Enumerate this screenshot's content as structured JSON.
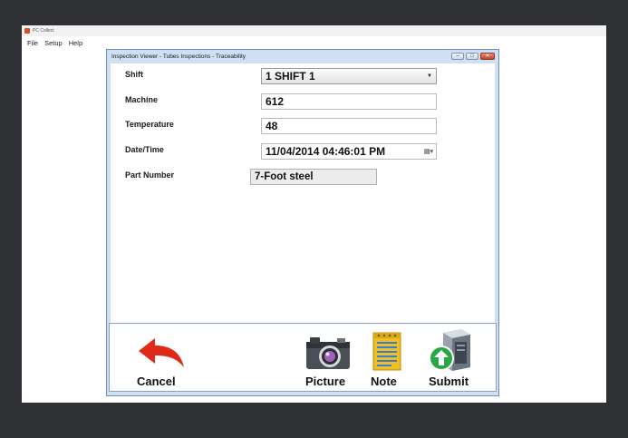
{
  "app": {
    "title": "PC Collect",
    "menu": [
      "File",
      "Setup",
      "Help"
    ]
  },
  "dialog": {
    "title": "Inspection Viewer - Tubes Inspections - Traceability"
  },
  "form": {
    "shift": {
      "label": "Shift",
      "value": "1 SHIFT 1"
    },
    "machine": {
      "label": "Machine",
      "value": "612"
    },
    "temperature": {
      "label": "Temperature",
      "value": "48"
    },
    "datetime": {
      "label": "Date/Time",
      "value": "11/04/2014 04:46:01 PM"
    },
    "part_number": {
      "label": "Part Number",
      "value": "7-Foot steel"
    }
  },
  "toolbar": {
    "cancel_label": "Cancel",
    "picture_label": "Picture",
    "note_label": "Note",
    "submit_label": "Submit"
  },
  "icons": {
    "cancel": "back-arrow-icon",
    "picture": "camera-icon",
    "note": "notepad-icon",
    "submit": "submit-server-icon"
  },
  "colors": {
    "cancel_arrow": "#e02a18",
    "camera_lens": "#a060c0",
    "note_pad": "#f0c020",
    "submit_arrow": "#27a844"
  }
}
